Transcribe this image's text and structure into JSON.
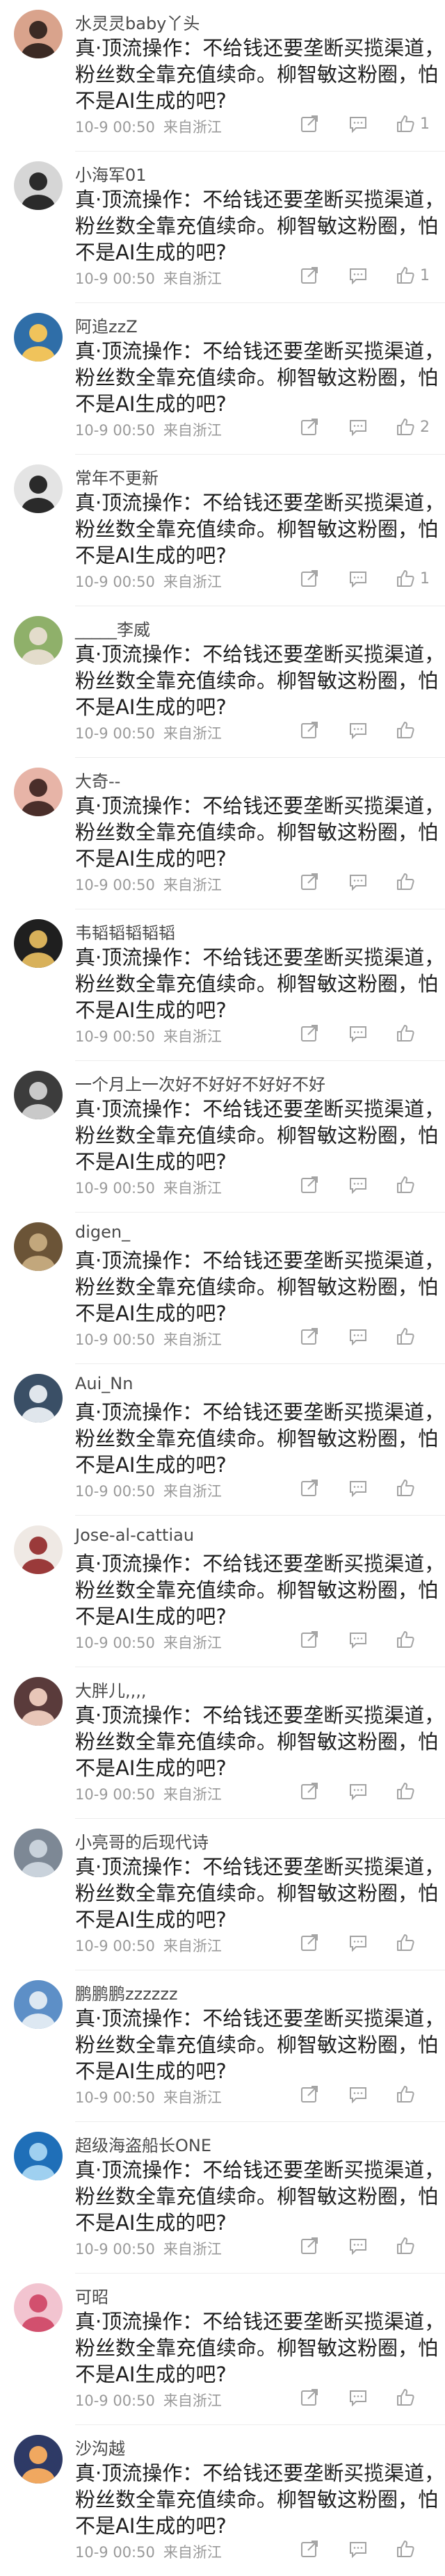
{
  "comment_text_lines": [
    "真·顶流操作：不给钱还要垄断买揽渠道，",
    "粉丝数全靠充值续命。柳智敏这粉圈，怕",
    "不是AI生成的吧?"
  ],
  "comments": [
    {
      "username": "水灵灵baby丫头",
      "time": "10-9 00:50",
      "location": "来自浙江",
      "likes": "1",
      "avatar_icon": "avatar-girl-icon",
      "avatar_colors": [
        "#d9a38c",
        "#3b2a24"
      ]
    },
    {
      "username": "小海军01",
      "time": "10-9 00:50",
      "location": "来自浙江",
      "likes": "1",
      "avatar_icon": "avatar-man-icon",
      "avatar_colors": [
        "#d6d6d6",
        "#2b2b2b"
      ]
    },
    {
      "username": "阿追zzZ",
      "time": "10-9 00:50",
      "location": "来自浙江",
      "likes": "2",
      "avatar_icon": "avatar-cartoon-icon",
      "avatar_colors": [
        "#2f6ea8",
        "#f0c35b"
      ]
    },
    {
      "username": "常年不更新",
      "time": "10-9 00:50",
      "location": "来自浙江",
      "likes": "1",
      "avatar_icon": "avatar-silhouette-icon",
      "avatar_colors": [
        "#e4e4e4",
        "#2a2a2a"
      ]
    },
    {
      "username": "_____李威",
      "time": "10-9 00:50",
      "location": "来自浙江",
      "likes": "",
      "avatar_icon": "avatar-landscape-icon",
      "avatar_colors": [
        "#8fb06a",
        "#e3dccb"
      ]
    },
    {
      "username": "大奇--",
      "time": "10-9 00:50",
      "location": "来自浙江",
      "likes": "",
      "avatar_icon": "avatar-girl-icon",
      "avatar_colors": [
        "#e7b4a7",
        "#4a2e2a"
      ]
    },
    {
      "username": "韦韬韬韬韬韬",
      "time": "10-9 00:50",
      "location": "来自浙江",
      "likes": "",
      "avatar_icon": "avatar-calligraphy-icon",
      "avatar_colors": [
        "#1f1f1f",
        "#d8b15a"
      ]
    },
    {
      "username": "一个月上一次好不好好不好好不好",
      "time": "10-9 00:50",
      "location": "来自浙江",
      "likes": "",
      "avatar_icon": "avatar-man-icon",
      "avatar_colors": [
        "#3c3c3c",
        "#c9c9c9"
      ]
    },
    {
      "username": "digen_",
      "time": "10-9 00:50",
      "location": "来自浙江",
      "likes": "",
      "avatar_icon": "avatar-pet-icon",
      "avatar_colors": [
        "#6b5437",
        "#c2a77c"
      ]
    },
    {
      "username": "Aui_Nn",
      "time": "10-9 00:50",
      "location": "来自浙江",
      "likes": "",
      "avatar_icon": "avatar-cartoon-icon",
      "avatar_colors": [
        "#3a4f66",
        "#e0e6ec"
      ]
    },
    {
      "username": "Jose-al-cattiau",
      "time": "10-9 00:50",
      "location": "来自浙江",
      "likes": "",
      "avatar_icon": "avatar-figure-icon",
      "avatar_colors": [
        "#efe9e4",
        "#9a3a3a"
      ]
    },
    {
      "username": "大胖儿,,,,",
      "time": "10-9 00:50",
      "location": "来自浙江",
      "likes": "",
      "avatar_icon": "avatar-girl-icon",
      "avatar_colors": [
        "#5a3b3b",
        "#e8c6b8"
      ]
    },
    {
      "username": "小亮哥的后现代诗",
      "time": "10-9 00:50",
      "location": "来自浙江",
      "likes": "",
      "avatar_icon": "avatar-city-icon",
      "avatar_colors": [
        "#7d8895",
        "#c9d2db"
      ]
    },
    {
      "username": "鹏鹏鹏zzzzzz",
      "time": "10-9 00:50",
      "location": "来自浙江",
      "likes": "",
      "avatar_icon": "avatar-landscape-icon",
      "avatar_colors": [
        "#5d8fc7",
        "#dde8f2"
      ]
    },
    {
      "username": "超级海盗船长ONE",
      "time": "10-9 00:50",
      "location": "来自浙江",
      "likes": "",
      "avatar_icon": "avatar-cartoon-icon",
      "avatar_colors": [
        "#1f6fb8",
        "#9fd0f0"
      ]
    },
    {
      "username": "可昭",
      "time": "10-9 00:50",
      "location": "来自浙江",
      "likes": "",
      "avatar_icon": "avatar-flower-icon",
      "avatar_colors": [
        "#f2c4d0",
        "#d2506e"
      ]
    },
    {
      "username": "沙沟越",
      "time": "10-9 00:50",
      "location": "来自浙江",
      "likes": "",
      "avatar_icon": "avatar-sunset-icon",
      "avatar_colors": [
        "#2e3a66",
        "#f0a860"
      ]
    }
  ]
}
